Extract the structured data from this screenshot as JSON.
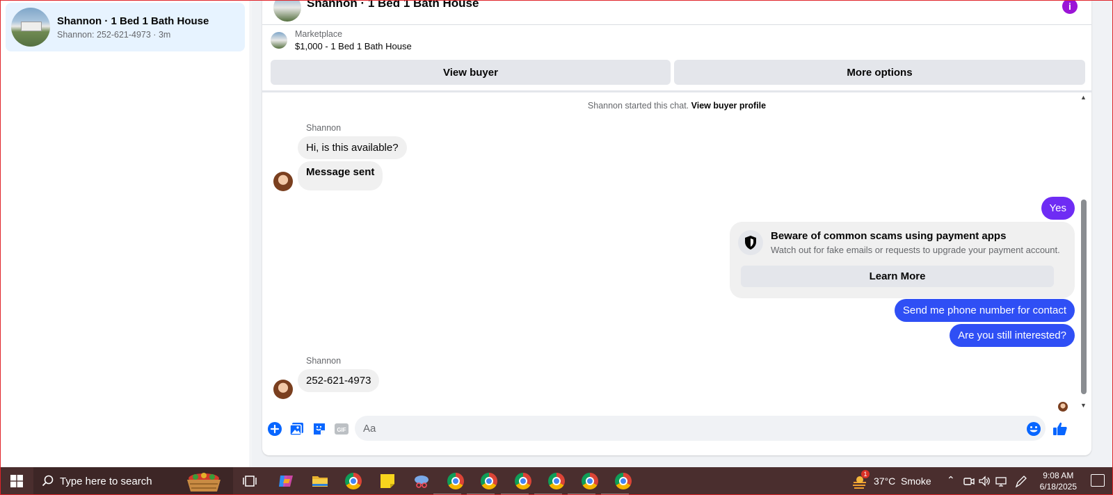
{
  "sidebar": {
    "conversation": {
      "title": "Shannon · 1 Bed 1 Bath House",
      "subtitle": "Shannon: 252-621-4973 · 3m"
    }
  },
  "header": {
    "title": "Shannon · 1 Bed 1 Bath House"
  },
  "listing": {
    "category": "Marketplace",
    "price_title": "$1,000 - 1 Bed 1 Bath House"
  },
  "actions": {
    "view_buyer": "View buyer",
    "more_options": "More options"
  },
  "chat": {
    "started_text": "Shannon started this chat.",
    "view_buyer_profile": "View buyer profile",
    "messages": [
      {
        "sender": "Shannon",
        "text": "Hi, is this available?"
      },
      {
        "text": "Message sent"
      },
      {
        "text": "Yes"
      },
      {
        "text": "Send me phone number for contact"
      },
      {
        "text": "Are you still interested?"
      },
      {
        "sender": "Shannon",
        "text": "252-621-4973"
      }
    ],
    "scam_notice": {
      "title": "Beware of common scams using payment apps",
      "text": "Watch out for fake emails or requests to upgrade your payment account.",
      "button": "Learn More"
    }
  },
  "composer": {
    "placeholder": "Aa",
    "icons": [
      "plus-icon",
      "photo-icon",
      "sticker-icon",
      "gif-icon",
      "emoji-icon",
      "thumbs-up-icon"
    ]
  },
  "taskbar": {
    "search_placeholder": "Type here to search",
    "weather": "37°C  Smoke",
    "weather_badge": "1",
    "time": "9:08 AM",
    "date": "6/18/2025"
  },
  "colors": {
    "accent_blue": "#2f4ff5",
    "accent_purple": "#6e2cf4",
    "icon_blue": "#0866ff",
    "taskbar": "#4a2e2e"
  }
}
